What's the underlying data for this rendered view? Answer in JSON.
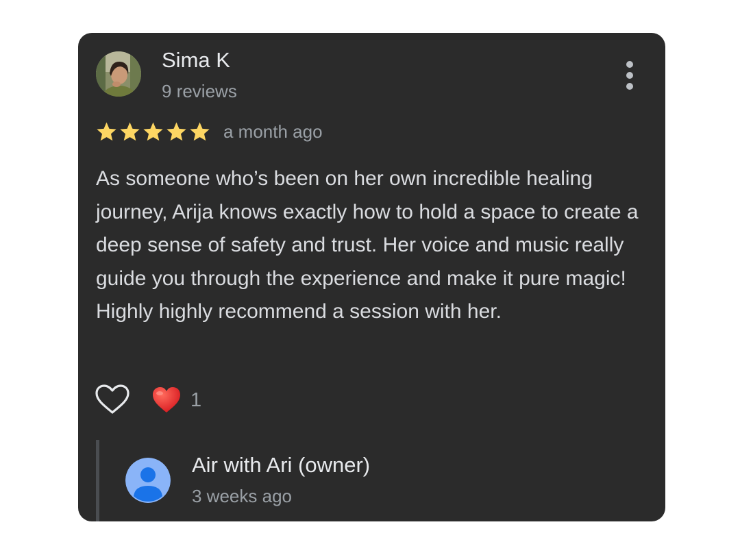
{
  "review": {
    "author": {
      "name": "Sima K",
      "meta": "9 reviews",
      "avatar_icon": "user-photo-avatar"
    },
    "rating": 5,
    "rating_max": 5,
    "date": "a month ago",
    "text": "As someone who’s been on her own incredible healing journey, Arija knows exactly how to hold a space to create a deep sense of safety and trust. Her voice and music really guide you through the experience and make it pure magic! Highly highly recommend a session with her.",
    "more_icon": "more-vertical-icon",
    "like_icon": "heart-outline-icon",
    "reaction": {
      "icon": "red-heart-emoji",
      "count": "1"
    }
  },
  "owner_reply": {
    "name": "Air with Ari (owner)",
    "date": "3 weeks ago",
    "avatar_icon": "default-person-avatar"
  },
  "colors": {
    "card_background": "#2b2b2b",
    "star": "#fdd663",
    "primary_text": "#e8eaed",
    "secondary_text": "#9aa0a6",
    "body_text": "#dadce0",
    "owner_avatar": "#8ab4f8"
  }
}
